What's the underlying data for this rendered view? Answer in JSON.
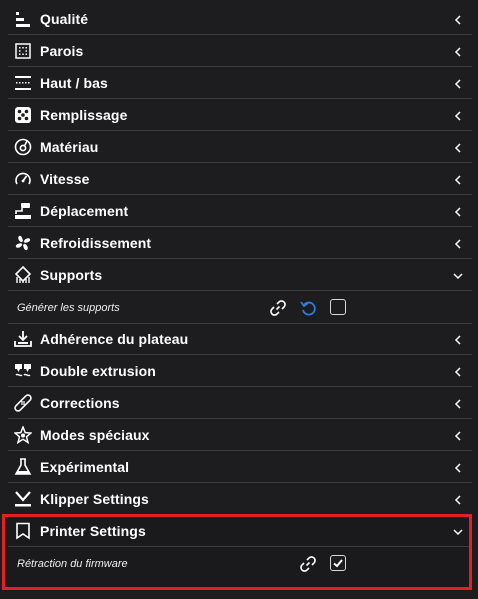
{
  "sections": [
    {
      "label": "Qualité",
      "icon": "quality-icon",
      "expanded": false
    },
    {
      "label": "Parois",
      "icon": "walls-icon",
      "expanded": false
    },
    {
      "label": "Haut / bas",
      "icon": "top-bottom-icon",
      "expanded": false
    },
    {
      "label": "Remplissage",
      "icon": "infill-icon",
      "expanded": false
    },
    {
      "label": "Matériau",
      "icon": "material-icon",
      "expanded": false
    },
    {
      "label": "Vitesse",
      "icon": "speed-icon",
      "expanded": false
    },
    {
      "label": "Déplacement",
      "icon": "travel-icon",
      "expanded": false
    },
    {
      "label": "Refroidissement",
      "icon": "cooling-fan-icon",
      "expanded": false
    },
    {
      "label": "Supports",
      "icon": "support-icon",
      "expanded": true
    },
    {
      "label": "Adhérence du plateau",
      "icon": "adhesion-icon",
      "expanded": false
    },
    {
      "label": "Double extrusion",
      "icon": "dual-extrusion-icon",
      "expanded": false
    },
    {
      "label": "Corrections",
      "icon": "bandage-icon",
      "expanded": false
    },
    {
      "label": "Modes spéciaux",
      "icon": "star-icon",
      "expanded": false
    },
    {
      "label": "Expérimental",
      "icon": "flask-icon",
      "expanded": false
    },
    {
      "label": "Klipper Settings",
      "icon": "klipper-icon",
      "expanded": false
    },
    {
      "label": "Printer Settings",
      "icon": "bookmark-icon",
      "expanded": true
    }
  ],
  "supports_setting": {
    "label": "Générer les supports",
    "checked": false
  },
  "printer_setting": {
    "label": "Rétraction du firmware",
    "checked": true
  },
  "colors": {
    "background": "#1d1d1f",
    "text": "#ffffff",
    "divider": "#3c3c3e",
    "reset_blue": "#2a7de1",
    "highlight_red": "#e32026"
  }
}
